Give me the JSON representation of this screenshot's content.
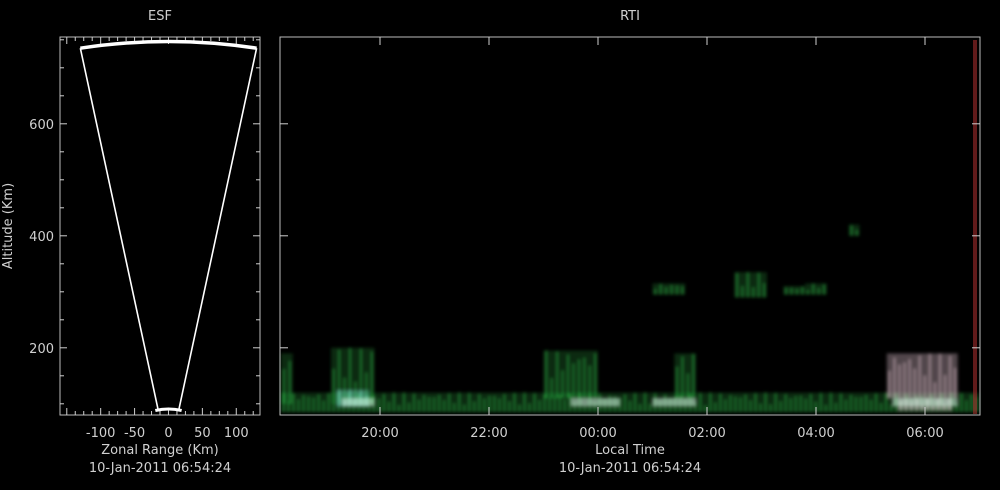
{
  "colors": {
    "background": "#000000",
    "text": "#d0d0d0",
    "frame": "#bdbdbd",
    "cone": "#ffffff",
    "echo_green": "#2fbf4a",
    "echo_cyan": "#7fe0d0",
    "echo_pink": "#e9c9d6",
    "colorbar_red": "#b03030"
  },
  "chart_data": [
    {
      "type": "other",
      "title": "ESF",
      "xlabel": "Zonal Range (Km)",
      "ylabel": "Altitude (Km)",
      "timestamp": "10-Jan-2011 06:54:24",
      "xlim": [
        -160,
        135
      ],
      "ylim": [
        80,
        755
      ],
      "xticks": [
        -100,
        -50,
        0,
        50,
        100
      ],
      "yticks": [
        200,
        400,
        600
      ],
      "beam": {
        "apex_range": [
          -15,
          15
        ],
        "apex_altitude": 88,
        "edge_range": [
          -130,
          130
        ],
        "edge_altitude": 735,
        "top_altitude": 747
      }
    },
    {
      "type": "heatmap",
      "title": "RTI",
      "xlabel": "Local Time",
      "timestamp": "10-Jan-2011 06:54:24",
      "xlim": [
        18.0,
        7.0
      ],
      "ylim": [
        80,
        755
      ],
      "xticks": [
        {
          "hour": 20,
          "label": "20:00"
        },
        {
          "hour": 22,
          "label": "22:00"
        },
        {
          "hour": 24,
          "label": "00:00"
        },
        {
          "hour": 26,
          "label": "02:00"
        },
        {
          "hour": 28,
          "label": "04:00"
        },
        {
          "hour": 30,
          "label": "06:00"
        }
      ],
      "yticks": [
        200,
        400,
        600
      ],
      "echo_regions": [
        {
          "t0": 18.0,
          "t1": 31.0,
          "a0": 85,
          "a1": 120,
          "color": "green"
        },
        {
          "t0": 19.1,
          "t1": 19.9,
          "a0": 100,
          "a1": 200,
          "color": "green"
        },
        {
          "t0": 18.0,
          "t1": 18.4,
          "a0": 100,
          "a1": 190,
          "color": "green"
        },
        {
          "t0": 23.0,
          "t1": 24.0,
          "a0": 110,
          "a1": 195,
          "color": "green"
        },
        {
          "t0": 25.4,
          "t1": 25.8,
          "a0": 110,
          "a1": 190,
          "color": "green"
        },
        {
          "t0": 29.3,
          "t1": 30.6,
          "a0": 110,
          "a1": 190,
          "color": "pink"
        },
        {
          "t0": 19.2,
          "t1": 19.8,
          "a0": 95,
          "a1": 125,
          "color": "cyan"
        },
        {
          "t0": 29.5,
          "t1": 30.5,
          "a0": 88,
          "a1": 110,
          "color": "pink"
        },
        {
          "t0": 25.0,
          "t1": 25.6,
          "a0": 295,
          "a1": 315,
          "color": "green"
        },
        {
          "t0": 26.5,
          "t1": 27.1,
          "a0": 290,
          "a1": 335,
          "color": "green"
        },
        {
          "t0": 27.4,
          "t1": 27.8,
          "a0": 295,
          "a1": 310,
          "color": "green"
        },
        {
          "t0": 27.8,
          "t1": 28.2,
          "a0": 295,
          "a1": 315,
          "color": "green"
        },
        {
          "t0": 28.6,
          "t1": 28.8,
          "a0": 400,
          "a1": 420,
          "color": "green"
        }
      ]
    }
  ]
}
